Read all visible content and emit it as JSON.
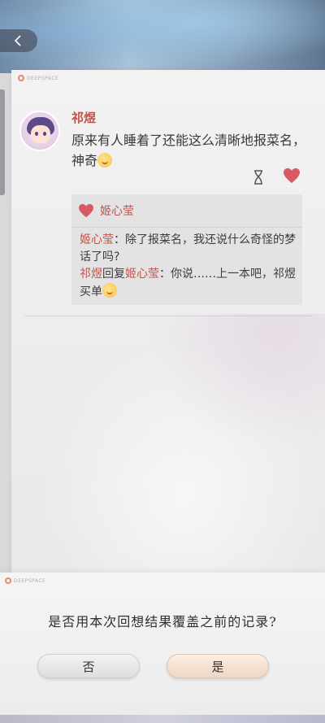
{
  "post": {
    "author": "祁煜",
    "text": "原来有人睡着了还能这么清晰地报菜名，神奇"
  },
  "comments": {
    "liker": "姬心莹",
    "c1": {
      "name": "姬心莹",
      "sep": "：",
      "text": "除了报菜名，我还说什么奇怪的梦话了吗?"
    },
    "c2": {
      "name": "祁煜",
      "reply_word": "回复",
      "reply_to": "姬心莹",
      "sep": "：",
      "text": "你说……上一本吧，祁煜买单"
    }
  },
  "dialog": {
    "question": "是否用本次回想结果覆盖之前的记录?",
    "no_label": "否",
    "yes_label": "是"
  },
  "colors": {
    "accent": "#c0524a"
  }
}
